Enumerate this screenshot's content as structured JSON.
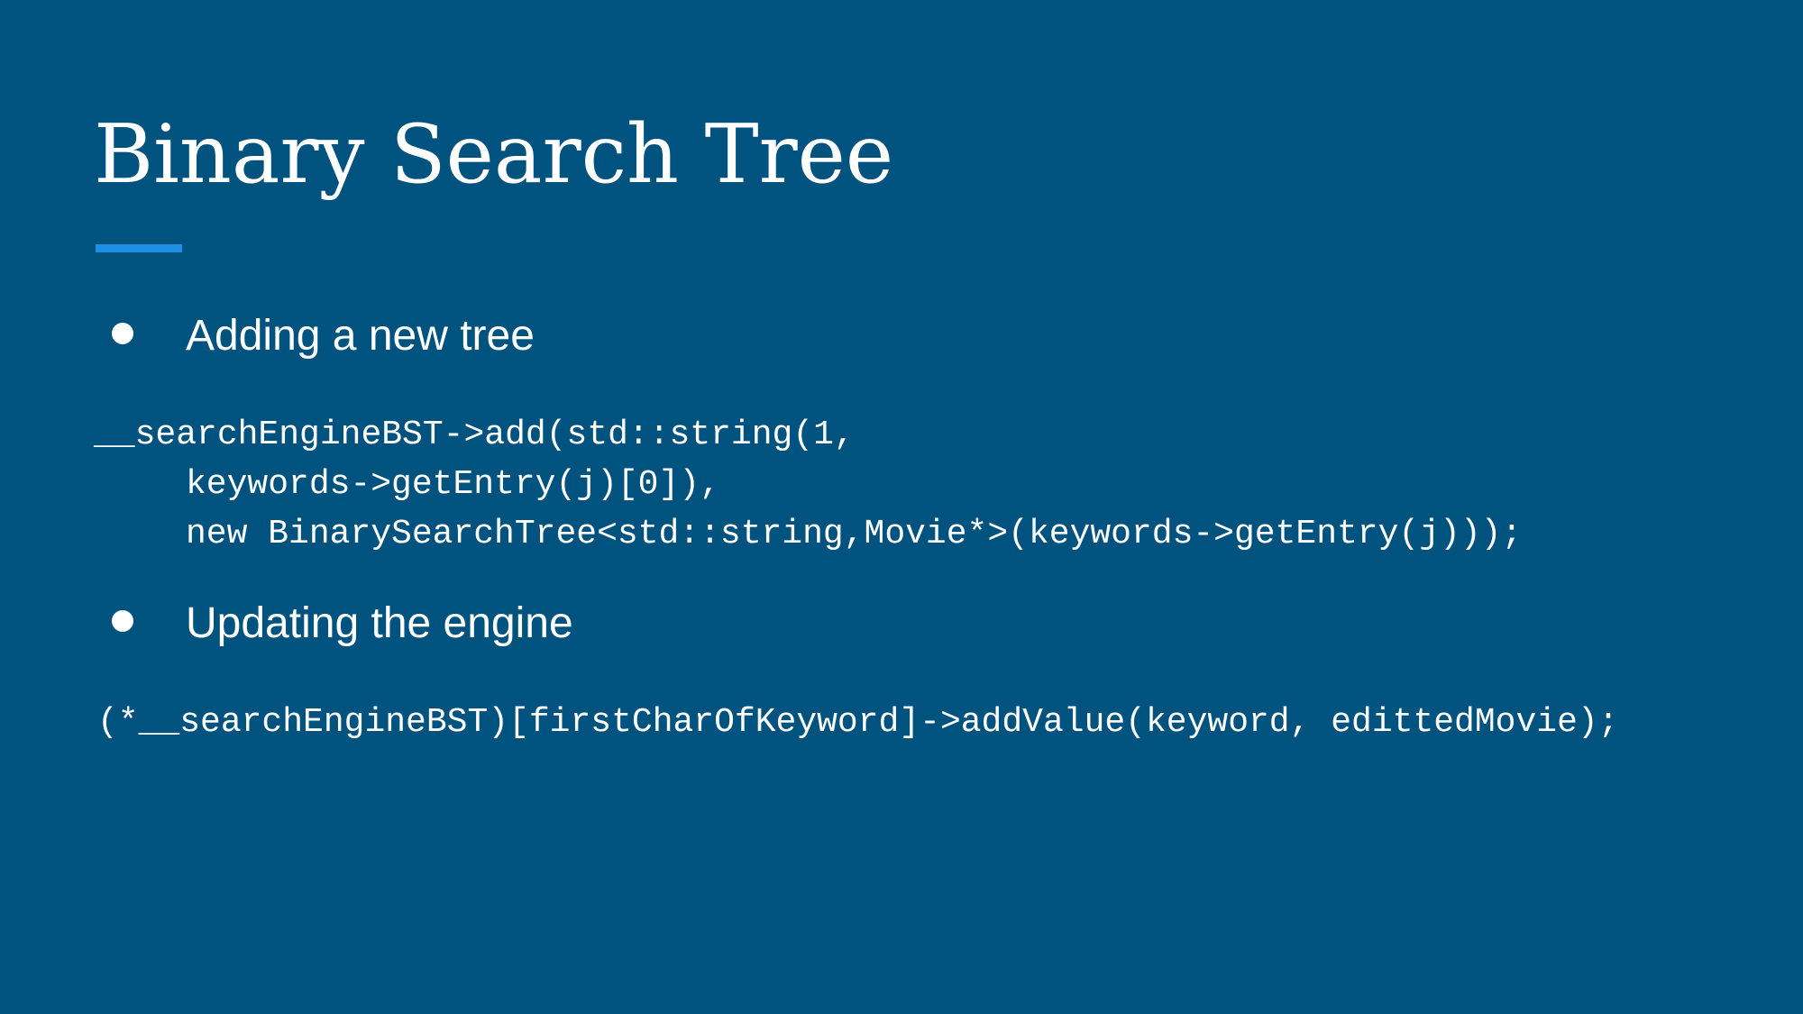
{
  "slide": {
    "title": "Binary Search Tree",
    "background_color": "#00527f",
    "accent_color": "#1e8fe4",
    "bullets": [
      {
        "text": "Adding a new tree",
        "code_lines": [
          "__searchEngineBST->add(std::string(1,",
          "keywords->getEntry(j)[0]),",
          "new BinarySearchTree<std::string,Movie*>(keywords->getEntry(j)));"
        ]
      },
      {
        "text": "Updating the engine",
        "code_lines": [
          "(*__searchEngineBST)[firstCharOfKeyword]->addValue(keyword, edittedMovie);"
        ]
      }
    ]
  }
}
